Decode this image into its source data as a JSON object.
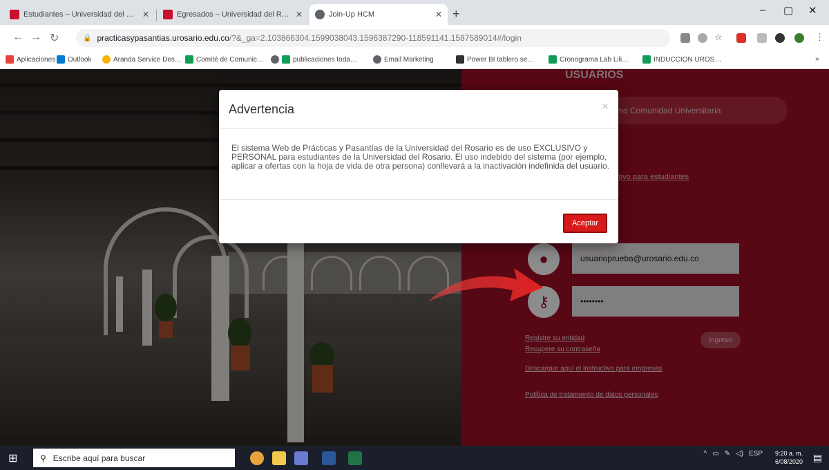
{
  "tabs": [
    {
      "title": "Estudiantes – Universidad del R…",
      "active": false,
      "color": "#c8102e"
    },
    {
      "title": "Egresados – Universidad del Ros…",
      "active": false,
      "color": "#c8102e"
    },
    {
      "title": "Join-Up HCM",
      "active": true,
      "color": "#5f6368"
    }
  ],
  "new_tab_label": "+",
  "window_controls": {
    "minimize": "–",
    "restore": "▢",
    "close": "✕"
  },
  "address": {
    "domain": "practicasypasantias.urosario.edu.co",
    "path": "/?&_ga=2.103866304.1599038043.1596387290-118591141.1587589014#/login"
  },
  "bookmarks": [
    {
      "label": "Aplicaciones",
      "color": "#e94235"
    },
    {
      "label": "Outlook",
      "color": "#0078d4"
    },
    {
      "label": "Aranda Service Des…",
      "color": "#f4b400"
    },
    {
      "label": "Comité de Comunic…",
      "color": "#0f9d58"
    },
    {
      "label": "publicaciones toda…",
      "color": "#0f9d58"
    },
    {
      "label": "Email Marketing",
      "color": "#5f6368"
    },
    {
      "label": "Power BI tablero se…",
      "color": "#333333"
    },
    {
      "label": "Cronograma Lab Lili…",
      "color": "#0f9d58"
    },
    {
      "label": "INDUCCION UROS…",
      "color": "#0f9d58"
    }
  ],
  "bookmarks_more": "»",
  "panel": {
    "title": "USUARIOS",
    "community_pill": "mo Comunidad Universitaria",
    "student_instructive": "uctivo para estudiantes",
    "username": "usuarioprueba@urosario.edu.co",
    "password_mask": "••••••••",
    "register_link": "Registre su entidad",
    "recover_link": "Recupere su contraseña",
    "ingreso_button": "Ingreso",
    "companies_link": "Descargue aquí el instructivo para empresas",
    "policy_link": "Política de tratamiento de datos personales",
    "accent": "#a10d25"
  },
  "modal": {
    "title": "Advertencia",
    "close": "×",
    "body": "El sistema Web de Prácticas y Pasantías de la Universidad del Rosario es de uso EXCLUSIVO y PERSONAL para estudiantes de la Universidad del Rosario. El uso indebido del sistema (por ejemplo, aplicar a ofertas con la hoja de vida de otra persona) conllevará a la inactivación indefinida del usuario.",
    "accept_button": "Aceptar"
  },
  "taskbar": {
    "search_placeholder": "Escribe aquí para buscar",
    "language": "ESP",
    "time": "9:20 a. m.",
    "date": "6/08/2020"
  }
}
